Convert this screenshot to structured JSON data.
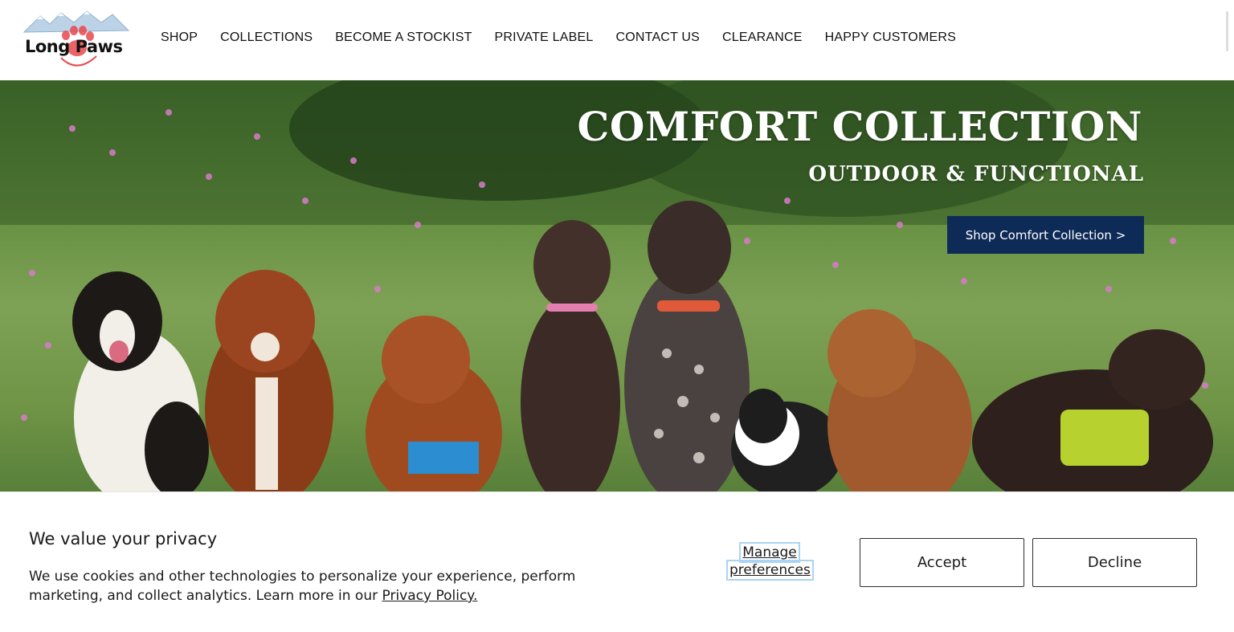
{
  "brand": {
    "name": "Long Paws",
    "logo_icon": "paw-mountain-logo"
  },
  "nav": {
    "items": [
      {
        "label": "SHOP"
      },
      {
        "label": "COLLECTIONS"
      },
      {
        "label": "BECOME A STOCKIST"
      },
      {
        "label": "PRIVATE LABEL"
      },
      {
        "label": "CONTACT US"
      },
      {
        "label": "CLEARANCE"
      },
      {
        "label": "HAPPY CUSTOMERS"
      }
    ]
  },
  "hero": {
    "title": "COMFORT COLLECTION",
    "subtitle": "OUTDOOR & FUNCTIONAL",
    "cta_label": "Shop Comfort Collection >",
    "cta_color": "#0e2a57"
  },
  "privacy": {
    "title": "We value your privacy",
    "text": "We use cookies and other technologies to personalize your experience, perform marketing, and collect analytics. Learn more in our ",
    "link": "Privacy Policy.",
    "manage_line1": "Manage",
    "manage_line2": "preferences",
    "accept": "Accept",
    "decline": "Decline"
  }
}
